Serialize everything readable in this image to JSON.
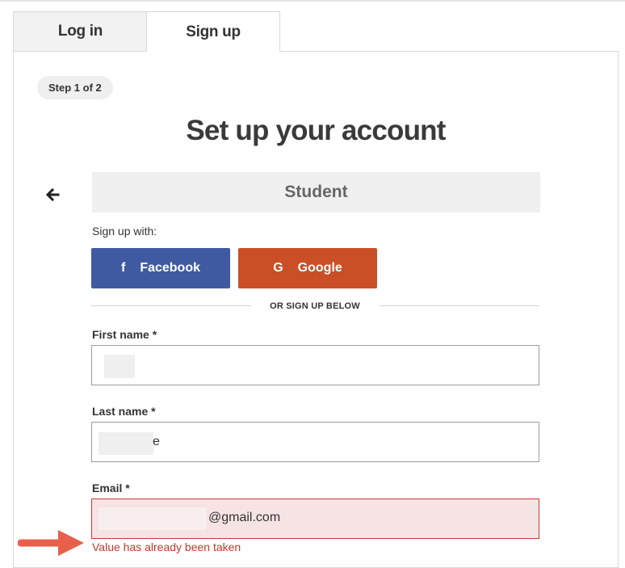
{
  "tabs": [
    {
      "label": "Log in",
      "active": false
    },
    {
      "label": "Sign up",
      "active": true
    }
  ],
  "step": "Step 1 of 2",
  "title": "Set up your account",
  "role": "Student",
  "signup_with": "Sign up with:",
  "social": {
    "facebook": {
      "label": "Facebook",
      "icon": "f",
      "color": "#3f5aa0"
    },
    "google": {
      "label": "Google",
      "icon": "G",
      "color": "#ca4f27"
    }
  },
  "divider": "OR SIGN UP BELOW",
  "form": {
    "first_name": {
      "label": "First name *",
      "value": ""
    },
    "last_name": {
      "label": "Last name *",
      "value": "e"
    },
    "email": {
      "label": "Email *",
      "value": "@gmail.com"
    }
  },
  "error": {
    "message": "Value has already been taken",
    "color": "#c0392b"
  },
  "annotation_arrow_color": "#e8604c"
}
